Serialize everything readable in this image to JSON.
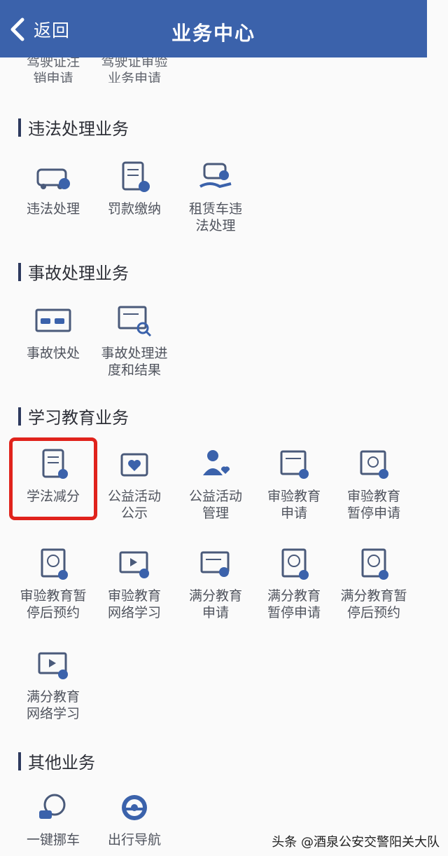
{
  "header": {
    "back_label": "返回",
    "title": "业务中心"
  },
  "top_partial": [
    {
      "label": "驾驶证注\n销申请"
    },
    {
      "label": "驾驶证审验\n业务申请"
    }
  ],
  "sections": [
    {
      "title": "违法处理业务",
      "items": [
        {
          "label": "违法处理",
          "icon": "car-ticket-icon"
        },
        {
          "label": "罚款缴纳",
          "icon": "fine-receipt-icon"
        },
        {
          "label": "租赁车违\n法处理",
          "icon": "rental-car-hand-icon"
        }
      ]
    },
    {
      "title": "事故处理业务",
      "items": [
        {
          "label": "事故快处",
          "icon": "accident-scene-icon"
        },
        {
          "label": "事故处理进\n度和结果",
          "icon": "accident-search-icon"
        }
      ]
    },
    {
      "title": "学习教育业务",
      "items": [
        {
          "label": "学法减分",
          "icon": "notebook-icon"
        },
        {
          "label": "公益活动\n公示",
          "icon": "heart-board-icon"
        },
        {
          "label": "公益活动\n管理",
          "icon": "volunteer-heart-icon"
        },
        {
          "label": "审验教育\n申请",
          "icon": "document-badge-icon"
        },
        {
          "label": "审验教育\n暂停申请",
          "icon": "clock-document-icon"
        },
        {
          "label": "审验教育暂\n停后预约",
          "icon": "clock-calendar-icon"
        },
        {
          "label": "审验教育\n网络学习",
          "icon": "video-play-icon"
        },
        {
          "label": "满分教育\n申请",
          "icon": "document-users-icon"
        },
        {
          "label": "满分教育\n暂停申请",
          "icon": "pause-document-icon"
        },
        {
          "label": "满分教育暂\n停后预约",
          "icon": "clock-calendar-icon"
        },
        {
          "label": "满分教育\n网络学习",
          "icon": "video-play-icon"
        }
      ]
    },
    {
      "title": "其他业务",
      "items": [
        {
          "label": "一键挪车",
          "icon": "move-car-icon"
        },
        {
          "label": "出行导航",
          "icon": "steering-wheel-icon"
        }
      ]
    }
  ],
  "watermark": "头条 @酒泉公安交警阳关大队",
  "colors": {
    "header": "#3b62ab",
    "highlight": "#e0231c",
    "icon_blue": "#3b62ab"
  }
}
